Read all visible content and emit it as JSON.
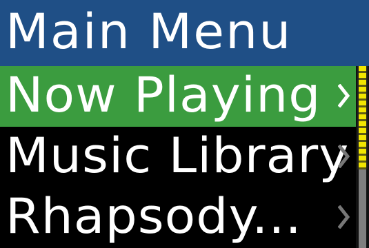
{
  "header": {
    "title": "Main Menu",
    "background_color": "#1f4f86"
  },
  "menu": {
    "items": [
      {
        "label": "Now Playing",
        "selected": true,
        "icon": "chevron-right-icon"
      },
      {
        "label": "Music Library",
        "selected": false,
        "icon": "chevron-right-icon"
      },
      {
        "label": "Rhapsody...",
        "selected": false,
        "icon": "chevron-right-icon"
      }
    ],
    "selected_color": "#3b9c3f",
    "text_color": "#ffffff"
  },
  "scrollbar": {
    "thumb_color": "#f2e600",
    "track_color": "#7f7f7f",
    "position_fraction": 0
  }
}
